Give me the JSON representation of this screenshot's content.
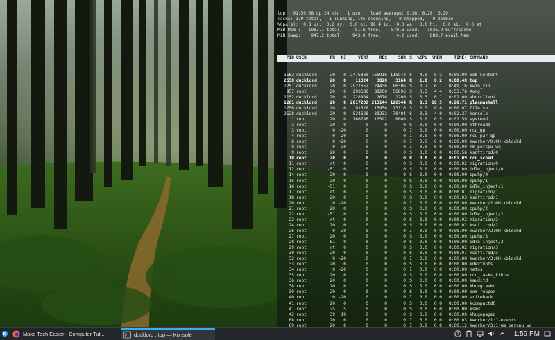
{
  "top": {
    "summary": [
      "top - 01:59:08 up 24 min,  1 user,  load average: 0.36, 0.28, 0.29",
      "Tasks: 179 total,   1 running, 145 sleeping,   0 stopped,   0 zombie",
      "%Cpu(s):  0.8 us,  0.2 sy,  0.0 ni, 98.4 id,  0.0 wa,  0.0 hi,  0.0 si,  0.0 st",
      "MiB Mem :   1987.1 total,     81.6 free,    878.6 used,   1026.9 buff/cache",
      "MiB Swap:    947.2 total,    943.0 free,      4.2 used.    889.7 avail Mem"
    ],
    "columns": [
      "PID",
      "USER",
      "PR",
      "NI",
      "VIRT",
      "RES",
      "SHR",
      "S",
      "%CPU",
      "%MEM",
      "TIME+",
      "COMMAND"
    ],
    "rows": [
      [
        "1562",
        "ducklord",
        "20",
        "0",
        "2476360",
        "166916",
        "115972",
        "S",
        "4.0",
        "8.2",
        "0:09.99",
        "Web Content"
      ],
      [
        "2558",
        "ducklord",
        "20",
        "0",
        "11824",
        "3828",
        "3164",
        "R",
        "1.0",
        "0.2",
        "0:00.48",
        "top"
      ],
      [
        "1251",
        "ducklord",
        "20",
        "0",
        "2927652",
        "124436",
        "86306",
        "S",
        "0.7",
        "6.1",
        "0:49.16",
        "kwin_x11"
      ],
      [
        "957",
        "root",
        "20",
        "0",
        "293680",
        "89200",
        "56896",
        "S",
        "0.3",
        "4.4",
        "0:53.76",
        "Xorg"
      ],
      [
        "1152",
        "ducklord",
        "20",
        "0",
        "228884",
        "2676",
        "2200",
        "S",
        "0.3",
        "0.1",
        "0:02.00",
        "vboxclient"
      ],
      [
        "1261",
        "ducklord",
        "20",
        "0",
        "2017232",
        "213144",
        "126944",
        "R",
        "0.3",
        "10.5",
        "0:20.71",
        "plasmashell"
      ],
      [
        "1750",
        "ducklord",
        "20",
        "0",
        "91528",
        "15956",
        "13116",
        "S",
        "0.3",
        "0.8",
        "0:00.07",
        "file.so"
      ],
      [
        "2528",
        "ducklord",
        "20",
        "0",
        "524628",
        "30232",
        "70404",
        "S",
        "0.3",
        "4.0",
        "0:02.37",
        "konsole"
      ],
      [
        "1",
        "root",
        "20",
        "0",
        "166796",
        "10592",
        "8000",
        "S",
        "0.0",
        "0.5",
        "0:02.59",
        "systemd"
      ],
      [
        "2",
        "root",
        "20",
        "0",
        "0",
        "0",
        "0",
        "S",
        "0.0",
        "0.0",
        "0:00.00",
        "kthreadd"
      ],
      [
        "3",
        "root",
        "0",
        "-20",
        "0",
        "0",
        "0",
        "I",
        "0.0",
        "0.0",
        "0:00.00",
        "rcu_gp"
      ],
      [
        "4",
        "root",
        "0",
        "-20",
        "0",
        "0",
        "0",
        "I",
        "0.0",
        "0.0",
        "0:00.00",
        "rcu_par_gp"
      ],
      [
        "6",
        "root",
        "0",
        "-20",
        "0",
        "0",
        "0",
        "I",
        "0.0",
        "0.0",
        "0:00.00",
        "kworker/0:0H-kblockd"
      ],
      [
        "8",
        "root",
        "0",
        "-20",
        "0",
        "0",
        "0",
        "I",
        "0.0",
        "0.0",
        "0:00.00",
        "mm_percpu_wq"
      ],
      [
        "9",
        "root",
        "20",
        "0",
        "0",
        "0",
        "0",
        "S",
        "0.0",
        "0.0",
        "0:00.56",
        "ksoftirqd/0"
      ],
      [
        "10",
        "root",
        "20",
        "0",
        "0",
        "0",
        "0",
        "R",
        "0.0",
        "0.0",
        "0:01.09",
        "rcu_sched"
      ],
      [
        "11",
        "root",
        "rt",
        "0",
        "0",
        "0",
        "0",
        "S",
        "0.0",
        "0.0",
        "0:00.02",
        "migration/0"
      ],
      [
        "12",
        "root",
        "-51",
        "0",
        "0",
        "0",
        "0",
        "S",
        "0.0",
        "0.0",
        "0:00.00",
        "idle_inject/0"
      ],
      [
        "14",
        "root",
        "20",
        "0",
        "0",
        "0",
        "0",
        "S",
        "0.0",
        "0.0",
        "0:00.00",
        "cpuhp/0"
      ],
      [
        "15",
        "root",
        "20",
        "0",
        "0",
        "0",
        "0",
        "S",
        "0.0",
        "0.0",
        "0:00.00",
        "cpuhp/1"
      ],
      [
        "16",
        "root",
        "-51",
        "0",
        "0",
        "0",
        "0",
        "S",
        "0.0",
        "0.0",
        "0:00.00",
        "idle_inject/1"
      ],
      [
        "17",
        "root",
        "rt",
        "0",
        "0",
        "0",
        "0",
        "S",
        "0.0",
        "0.0",
        "0:00.01",
        "migration/1"
      ],
      [
        "18",
        "root",
        "20",
        "0",
        "0",
        "0",
        "0",
        "S",
        "0.0",
        "0.0",
        "0:00.03",
        "ksoftirqd/1"
      ],
      [
        "20",
        "root",
        "0",
        "-20",
        "0",
        "0",
        "0",
        "I",
        "0.0",
        "0.0",
        "0:00.00",
        "kworker/1:0H-kblockd"
      ],
      [
        "21",
        "root",
        "20",
        "0",
        "0",
        "0",
        "0",
        "S",
        "0.0",
        "0.0",
        "0:00.00",
        "cpuhp/2"
      ],
      [
        "22",
        "root",
        "-51",
        "0",
        "0",
        "0",
        "0",
        "S",
        "0.0",
        "0.0",
        "0:00.00",
        "idle_inject/2"
      ],
      [
        "23",
        "root",
        "rt",
        "0",
        "0",
        "0",
        "0",
        "S",
        "0.0",
        "0.0",
        "0:00.02",
        "migration/2"
      ],
      [
        "24",
        "root",
        "20",
        "0",
        "0",
        "0",
        "0",
        "S",
        "0.0",
        "0.0",
        "0:00.02",
        "ksoftirqd/2"
      ],
      [
        "26",
        "root",
        "0",
        "-20",
        "0",
        "0",
        "0",
        "I",
        "0.0",
        "0.0",
        "0:00.00",
        "kworker/2:0H-kblockd"
      ],
      [
        "27",
        "root",
        "20",
        "0",
        "0",
        "0",
        "0",
        "S",
        "0.0",
        "0.0",
        "0:00.00",
        "cpuhp/3"
      ],
      [
        "28",
        "root",
        "-51",
        "0",
        "0",
        "0",
        "0",
        "S",
        "0.0",
        "0.0",
        "0:00.00",
        "idle_inject/3"
      ],
      [
        "29",
        "root",
        "rt",
        "0",
        "0",
        "0",
        "0",
        "S",
        "0.0",
        "0.0",
        "0:00.02",
        "migration/3"
      ],
      [
        "30",
        "root",
        "20",
        "0",
        "0",
        "0",
        "0",
        "S",
        "0.0",
        "0.0",
        "0:00.07",
        "ksoftirqd/3"
      ],
      [
        "32",
        "root",
        "0",
        "-20",
        "0",
        "0",
        "0",
        "I",
        "0.0",
        "0.0",
        "0:00.00",
        "kworker/3:0H-kblockd"
      ],
      [
        "33",
        "root",
        "20",
        "0",
        "0",
        "0",
        "0",
        "S",
        "0.0",
        "0.0",
        "0:00.00",
        "kdevtmpfs"
      ],
      [
        "34",
        "root",
        "0",
        "-20",
        "0",
        "0",
        "0",
        "I",
        "0.0",
        "0.0",
        "0:00.00",
        "netns"
      ],
      [
        "35",
        "root",
        "20",
        "0",
        "0",
        "0",
        "0",
        "S",
        "0.0",
        "0.0",
        "0:00.00",
        "rcu_tasks_kthre"
      ],
      [
        "36",
        "root",
        "20",
        "0",
        "0",
        "0",
        "0",
        "S",
        "0.0",
        "0.0",
        "0:00.00",
        "kauditd"
      ],
      [
        "38",
        "root",
        "20",
        "0",
        "0",
        "0",
        "0",
        "S",
        "0.0",
        "0.0",
        "0:00.00",
        "khungtaskd"
      ],
      [
        "39",
        "root",
        "20",
        "0",
        "0",
        "0",
        "0",
        "S",
        "0.0",
        "0.0",
        "0:00.00",
        "oom_reaper"
      ],
      [
        "40",
        "root",
        "0",
        "-20",
        "0",
        "0",
        "0",
        "I",
        "0.0",
        "0.0",
        "0:00.00",
        "writeback"
      ],
      [
        "41",
        "root",
        "20",
        "0",
        "0",
        "0",
        "0",
        "S",
        "0.0",
        "0.0",
        "0:00.00",
        "kcompactd0"
      ],
      [
        "41",
        "root",
        "25",
        "5",
        "0",
        "0",
        "0",
        "S",
        "0.0",
        "0.0",
        "0:00.00",
        "ksmd"
      ],
      [
        "42",
        "root",
        "39",
        "19",
        "0",
        "0",
        "0",
        "S",
        "0.0",
        "0.0",
        "0:00.00",
        "khugepaged"
      ],
      [
        "68",
        "root",
        "20",
        "0",
        "0",
        "0",
        "0",
        "I",
        "0.0",
        "0.0",
        "0:00.03",
        "kworker/1:1-events"
      ],
      [
        "69",
        "root",
        "20",
        "0",
        "0",
        "0",
        "0",
        "I",
        "0.0",
        "0.0",
        "0:00.12",
        "kworker/3:1-mm_percpu_wq"
      ],
      [
        "136",
        "root",
        "20",
        "0",
        "0",
        "0",
        "0",
        "S",
        "0.0",
        "0.0",
        "0:00.00",
        "kintegrityd"
      ]
    ],
    "bold_pids": [
      "2558",
      "1261",
      "10"
    ]
  },
  "taskbar": {
    "firefox_task": "Make Tech Easier - Computer Tut...",
    "konsole_task": "ducklord : top — Konsole",
    "clock": "1:59 PM",
    "icons": [
      "kde-menu-icon",
      "firefox-icon",
      "konsole-icon",
      "network-icon",
      "volume-icon",
      "clipboard-icon",
      "notifications-icon",
      "expand-tray-icon",
      "show-desktop-icon"
    ]
  },
  "colors": {
    "panel": "#232629",
    "accent": "#3daee9",
    "header_bar": "#e8ecf0"
  }
}
